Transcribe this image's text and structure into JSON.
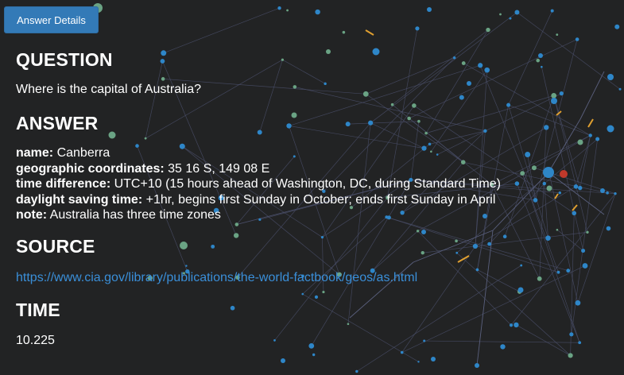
{
  "button": {
    "label": "Answer Details"
  },
  "question": {
    "heading": "QUESTION",
    "text": "Where is the capital of Australia?"
  },
  "answer": {
    "heading": "ANSWER",
    "fields": [
      {
        "key": "name:",
        "value": "Canberra"
      },
      {
        "key": "geographic coordinates:",
        "value": "35 16 S, 149 08 E"
      },
      {
        "key": "time difference:",
        "value": "UTC+10 (15 hours ahead of Washington, DC, during Standard Time)"
      },
      {
        "key": "daylight saving time:",
        "value": "+1hr, begins first Sunday in October; ends first Sunday in April"
      },
      {
        "key": "note:",
        "value": "Australia has three time zones"
      }
    ]
  },
  "source": {
    "heading": "SOURCE",
    "url": "https://www.cia.gov/library/publications/the-world-factbook/geos/as.html"
  },
  "time": {
    "heading": "TIME",
    "value": "10.225"
  },
  "colors": {
    "background": "#222324",
    "button": "#337ab7",
    "link": "#3a8fd9",
    "node_blue": "#2e86c8",
    "node_green": "#6aa384",
    "node_red": "#c0392b",
    "edge_orange": "#e0a030"
  }
}
